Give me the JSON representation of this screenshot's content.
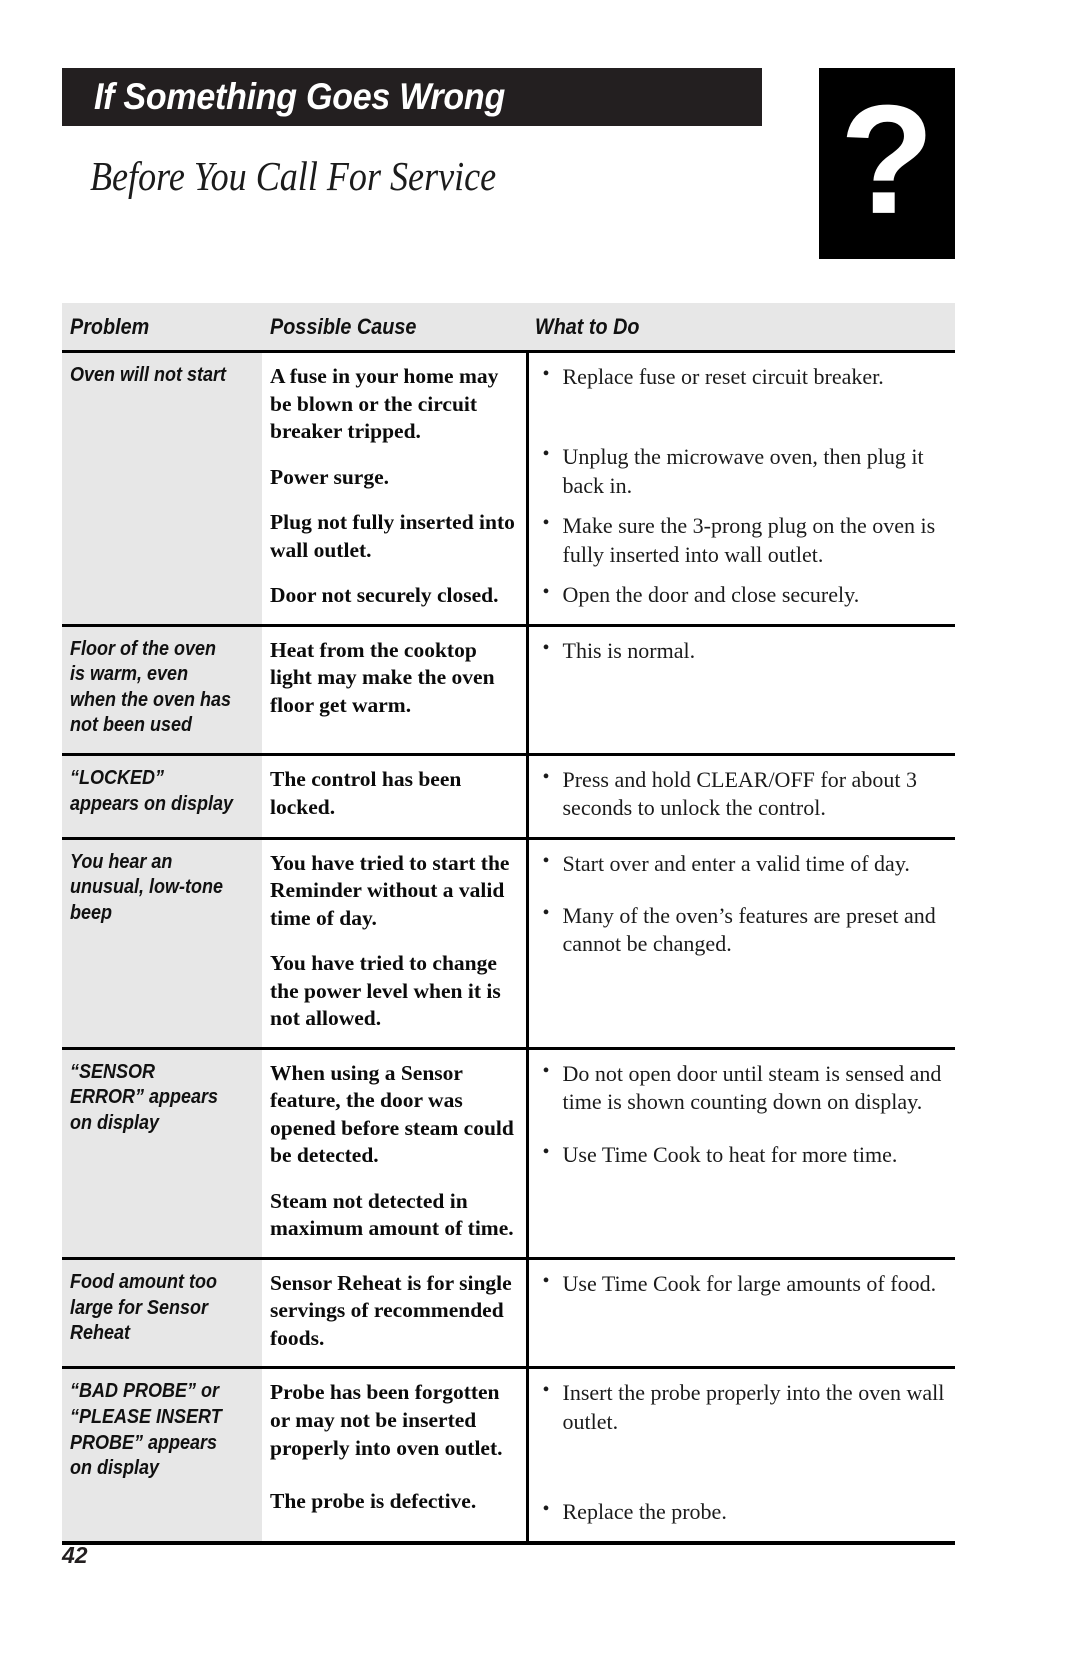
{
  "header": {
    "title": "If Something Goes Wrong",
    "subtitle": "Before You Call For Service",
    "question_mark_glyph": "?"
  },
  "table": {
    "columns": {
      "problem": "Problem",
      "possible_cause": "Possible Cause",
      "what_to_do": "What to Do"
    },
    "bullet_glyph": "•",
    "rows": [
      {
        "problem": "Oven will not start",
        "causes": [
          "A fuse in your home may be blown or the circuit breaker tripped.",
          "Power surge.",
          "Plug not fully inserted into wall outlet.",
          "Door not securely closed."
        ],
        "actions": [
          "Replace fuse or reset circuit breaker.",
          "Unplug the microwave oven, then plug it back in.",
          "Make sure the 3-prong plug on the oven is fully inserted into wall outlet.",
          "Open the door and close securely."
        ]
      },
      {
        "problem": "Floor of the oven is warm, even when the oven has not been used",
        "causes": [
          "Heat from the cooktop light may make the oven floor get warm."
        ],
        "actions": [
          "This is normal."
        ]
      },
      {
        "problem": "“LOCKED” appears on display",
        "causes": [
          "The control has been locked."
        ],
        "actions": [
          "Press and hold CLEAR/OFF for about 3 seconds to unlock the control."
        ]
      },
      {
        "problem": "You hear an unusual, low-tone beep",
        "causes": [
          "You have tried to start the Reminder without a valid time of day.",
          "You have tried to change the power level when it is not allowed."
        ],
        "actions": [
          "Start over and enter a valid time of day.",
          "Many of the oven’s features are preset and cannot be changed."
        ]
      },
      {
        "problem": "“SENSOR ERROR” appears on display",
        "causes": [
          "When using a Sensor feature, the door was opened before steam could be detected.",
          "Steam not detected in maximum amount of time."
        ],
        "actions": [
          "Do not open door until steam is sensed and time is shown counting down on display.",
          "Use Time Cook to heat for more time."
        ]
      },
      {
        "problem": "Food amount too large for Sensor Reheat",
        "causes": [
          "Sensor Reheat is for single servings of recommended foods."
        ],
        "actions": [
          "Use Time Cook for large amounts of food."
        ]
      },
      {
        "problem": "“BAD PROBE” or “PLEASE INSERT PROBE” appears on display",
        "causes": [
          "Probe has been forgotten or may not be inserted properly into oven outlet.",
          "The probe is defective."
        ],
        "actions": [
          "Insert the probe properly into the oven wall outlet.",
          "Replace the probe."
        ]
      }
    ]
  },
  "footer": {
    "page_number": "42"
  }
}
